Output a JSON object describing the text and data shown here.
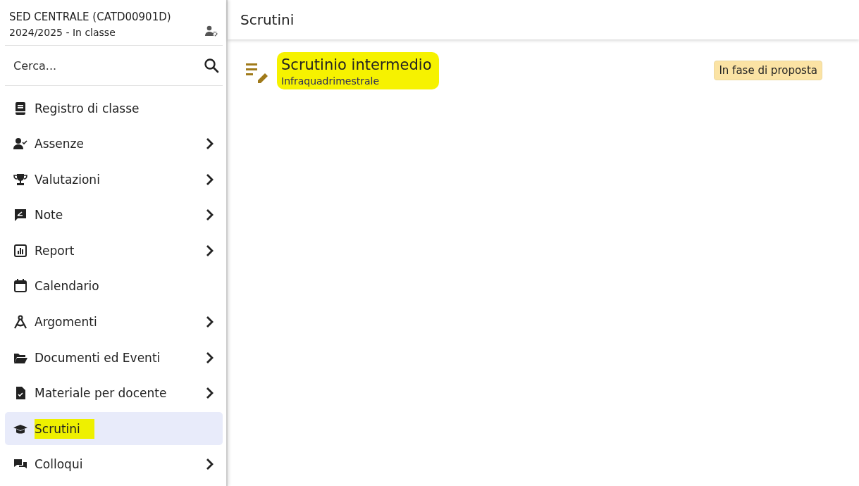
{
  "sidebar": {
    "school": "SED CENTRALE (CATD00901D)",
    "year": "2024/2025 - In classe",
    "search": {
      "placeholder": "Cerca..."
    },
    "items": [
      {
        "label": "Registro di classe",
        "submenu": false,
        "selected": false,
        "highlighted": false
      },
      {
        "label": "Assenze",
        "submenu": true,
        "selected": false,
        "highlighted": false
      },
      {
        "label": "Valutazioni",
        "submenu": true,
        "selected": false,
        "highlighted": false
      },
      {
        "label": "Note",
        "submenu": true,
        "selected": false,
        "highlighted": false
      },
      {
        "label": "Report",
        "submenu": true,
        "selected": false,
        "highlighted": false
      },
      {
        "label": "Calendario",
        "submenu": false,
        "selected": false,
        "highlighted": false
      },
      {
        "label": "Argomenti",
        "submenu": true,
        "selected": false,
        "highlighted": false
      },
      {
        "label": "Documenti ed Eventi",
        "submenu": true,
        "selected": false,
        "highlighted": false
      },
      {
        "label": "Materiale per docente",
        "submenu": true,
        "selected": false,
        "highlighted": false
      },
      {
        "label": "Scrutini",
        "submenu": false,
        "selected": true,
        "highlighted": true
      },
      {
        "label": "Colloqui",
        "submenu": true,
        "selected": false,
        "highlighted": false
      }
    ]
  },
  "page": {
    "title": "Scrutini",
    "scrutini": [
      {
        "title": "Scrutinio intermedio",
        "subtitle": "Infraquadrimestrale",
        "status": "In fase di proposta",
        "highlighted": true
      }
    ]
  }
}
